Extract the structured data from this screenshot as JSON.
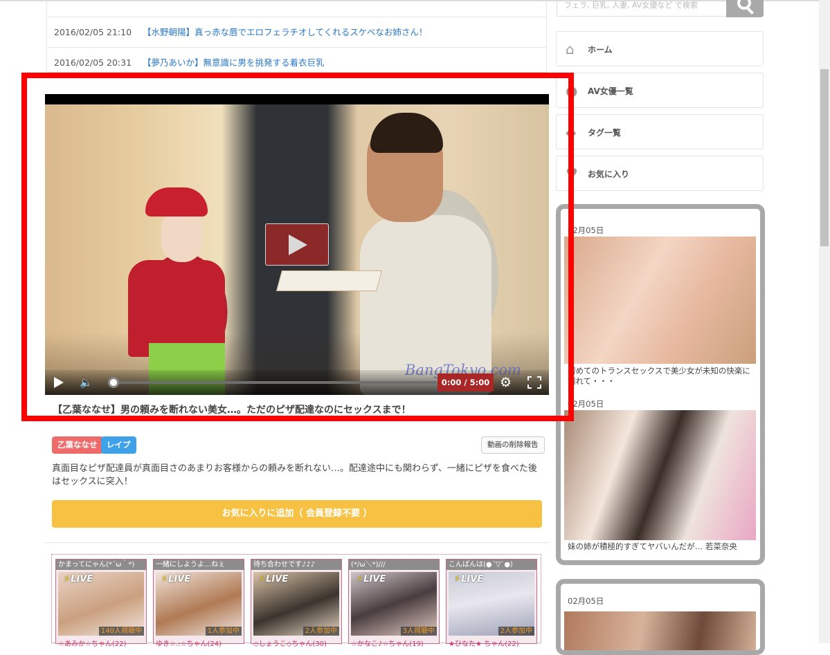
{
  "feed": [
    {
      "date": "2016/02/05 21:10",
      "title": "【水野朝陽】真っ赤な唇でエロフェラチオしてくれるスケベなお姉さん！"
    },
    {
      "date": "2016/02/05 20:31",
      "title": "【夢乃あいか】無意識に男を挑発する着衣巨乳"
    }
  ],
  "video": {
    "time": "0:00 / 5:00",
    "watermark": "BangTokyo.com",
    "progress": 0
  },
  "post": {
    "title": "【乙葉ななせ】男の頼みを断れない美女…。ただのピザ配達なのにセックスまで！",
    "tags": [
      "乙葉ななせ",
      "レイプ"
    ],
    "report_label": "動画の削除報告",
    "description": "真面目なピザ配達員が真面目さのあまりお客様からの頼みを断れない…。配達途中にも関わらず、一緒にピザを食べた後はセックスに突入！",
    "fav_label": "お気に入りに追加（ 会員登録不要 ）"
  },
  "live": [
    {
      "head": "かまってにゃん(*´ω｀*)",
      "badge": "LIVE",
      "count": "140人視聴中",
      "name": "☆あみか☆ちゃん(22)"
    },
    {
      "head": "一緒にしようよ…ねぇ",
      "badge": "LIVE",
      "count": "1人参加中",
      "name": "ゆき☆.:☆ちゃん(24)"
    },
    {
      "head": "待ち合わせです♪♪♪",
      "badge": "LIVE",
      "count": "2人参加中",
      "name": "◇しょうこ◇ちゃん(30)"
    },
    {
      "head": "(*/ω＼*)///",
      "badge": "LIVE",
      "count": "3人視聴中",
      "name": "☆かなこ♪☆ちゃん(19)"
    },
    {
      "head": "こんばんは(●´▽`●)",
      "badge": "LIVE",
      "count": "2人参加中",
      "name": "★ひなた★ ちゃん(22)"
    }
  ],
  "sidebar": {
    "search_placeholder": "フェラ, 巨乳, 人妻, AV女優など で検索",
    "nav": [
      {
        "label": "ホーム",
        "icon": "home-icon"
      },
      {
        "label": "AV女優一覧",
        "icon": "person-icon"
      },
      {
        "label": "タグ一覧",
        "icon": "tag-icon"
      },
      {
        "label": "お気に入り",
        "icon": "heart-icon"
      }
    ],
    "ranking": [
      {
        "date": "02月05日",
        "caption": "初めてのトランスセックスで美少女が未知の快楽に溺れて・・・"
      },
      {
        "date": "02月05日",
        "caption": "妹の姉が積極的すぎてヤバいんだが… 若菜奈央"
      },
      {
        "date": "02月05日",
        "caption": ""
      }
    ]
  },
  "colors": {
    "link": "#2a78c8",
    "fav_button": "#f7c243",
    "tag_pink": "#ee6b6b",
    "tag_blue": "#3fa2e8",
    "highlight": "#ff0000"
  }
}
